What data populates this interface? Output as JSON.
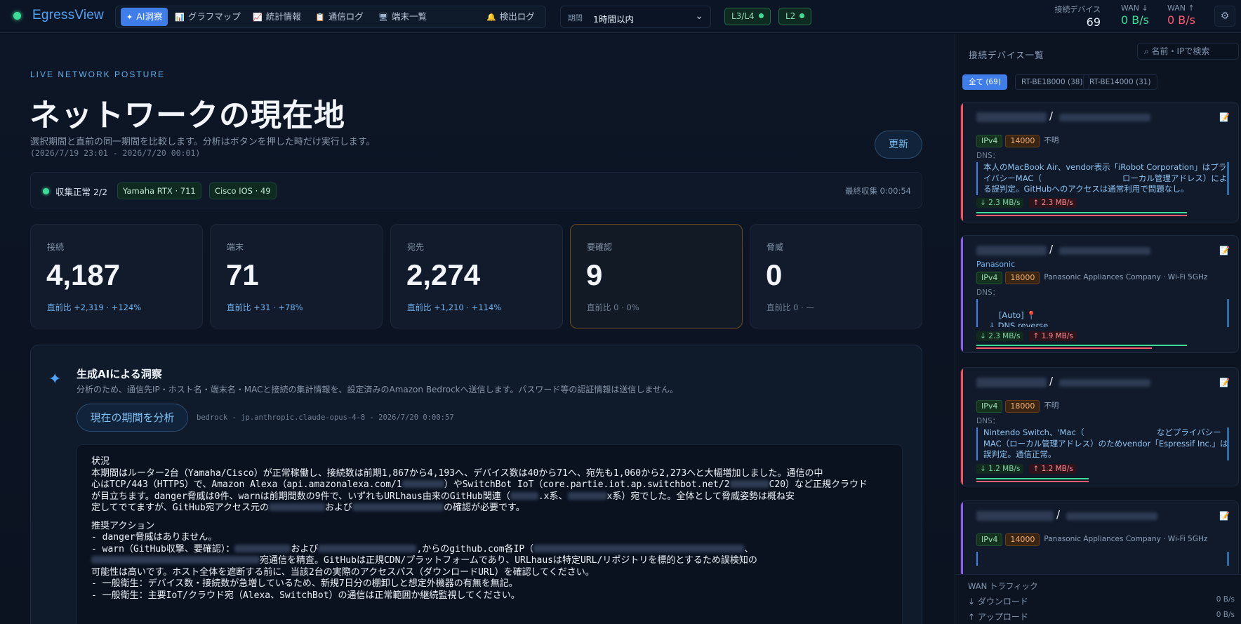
{
  "app": {
    "logo": "EgressView",
    "nav": [
      {
        "icon": "✦",
        "label": "AI洞察"
      },
      {
        "icon": "📊",
        "label": "グラフマップ"
      },
      {
        "icon": "📈",
        "label": "統計情報"
      },
      {
        "icon": "📋",
        "label": "通信ログ"
      },
      {
        "icon": "🖥",
        "label": "端末一覧"
      },
      {
        "icon": "🔔",
        "label": "検出ログ"
      }
    ],
    "period_label": "期間",
    "period_value": "1時間以内",
    "layers": [
      "L3/L4",
      "L2"
    ],
    "stats": {
      "devices_label": "接続デバイス",
      "devices_value": "69",
      "wan_down_label": "WAN ↓",
      "wan_down_value": "0 B/s",
      "wan_up_label": "WAN ↑",
      "wan_up_value": "0 B/s"
    }
  },
  "main": {
    "eyebrow": "LIVE NETWORK POSTURE",
    "title": "ネットワークの現在地",
    "subtitle": "選択期間と直前の同一期間を比較します。分析はボタンを押した時だけ実行します。",
    "range": "(2026/7/19 23:01 - 2026/7/20 00:01)",
    "refresh_label": "更新",
    "collect": {
      "status": "収集正常 2/2",
      "chips": [
        "Yamaha RTX · 711",
        "Cisco IOS · 49"
      ],
      "last": "最終収集 0:00:54"
    },
    "kpis": [
      {
        "label": "接続",
        "value": "4,187",
        "delta": "直前比 +2,319 · +124%"
      },
      {
        "label": "端末",
        "value": "71",
        "delta": "直前比 +31 · +78%"
      },
      {
        "label": "宛先",
        "value": "2,274",
        "delta": "直前比 +1,210 · +114%"
      },
      {
        "label": "要確認",
        "value": "9",
        "delta": "直前比 0 · 0%"
      },
      {
        "label": "脅威",
        "value": "0",
        "delta": "直前比 0 · —"
      }
    ],
    "ai": {
      "title": "生成AIによる洞察",
      "desc": "分析のため、通信先IP・ホスト名・端末名・MACと接続の集計情報を、設定済みのAmazon Bedrockへ送信します。パスワード等の認証情報は送信しません。",
      "analyze_label": "現在の期間を分析",
      "model": "bedrock - jp.anthropic.claude-opus-4-8 - 2026/7/20 0:00:57",
      "h1": "状況",
      "p1a": "本期間はルーター2台（Yamaha/Cisco）が正常稼働し、接続数は前期1,867から4,193へ、デバイス数は40から71へ、宛先も1,060から2,273へと大幅増加しました。通信の中",
      "p1b_pre": "心はTCP/443（HTTPS）で、Amazon Alexa（api.amazonalexa.com/1",
      "p1b_mid": "）やSwitchBot IoT（core.partie.iot.ap.switchbot.net/2",
      "p1b_post": "C20）など正規クラウド",
      "p1c_pre": "が目立ちます。danger脅威は0件、warnは前期間数の9件で、いずれもURLhaus由来のGitHub関連（",
      "p1c_mid": ".x系、",
      "p1c_post": "x系）宛でした。全体として脅威姿勢は概ね安",
      "p1d_pre": "定してでてますが、GitHub宛アクセス元の",
      "p1d_mid": "および",
      "p1d_post": "の確認が必要です。",
      "h2": "推奨アクション",
      "a1": "- danger脅威はありません。",
      "a2_pre": "- warn（GitHub収撃、要確認）：",
      "a2_mid": "および",
      "a2_post": ",からのgithub.com各IP（",
      "a2_end": "、",
      "a3_post": "宛通信を精査。GitHubは正規CDN/プラットフォームであり、URLhausは特定URL/リポジトリを標的とするため誤検知の",
      "a4": "可能性は高いです。ホスト全体を遮断する前に、当該2台の実際のアクセスパス（ダウンロードURL）を確認してください。",
      "a5": "- 一般衛生：デバイス数・接続数が急増しているため、新規7日分の棚卸しと想定外機器の有無を無記。",
      "a6": "- 一般衛生：主要IoT/クラウド宛（Alexa、SwitchBot）の通信は正常範囲か継続監視してください。"
    }
  },
  "sidebar": {
    "title": "接続デバイス一覧",
    "search_placeholder": "名前・IPで検索",
    "tabs": [
      "全て (69)",
      "RT-BE18000 (38)",
      "RT-BE14000 (31)"
    ],
    "devices": [
      {
        "accent": "#ff4d5e",
        "vendor": "",
        "ipv": "IPv4",
        "port": "14000",
        "info": "不明",
        "dns": "DNS：",
        "note": "本人のMacBook Air、vendor表示「iRobot Corporation」はプライバシーMAC（　　　　　　　　　　ローカル管理アドレス）による誤判定。GitHubへのアクセスは通常利用で問題なし。",
        "down": "↓ 2.3 MB/s",
        "up": "↑ 2.3 MB/s"
      },
      {
        "accent": "#8f5cf0",
        "vendor": "Panasonic",
        "ipv": "IPv4",
        "port": "18000",
        "info": "Panasonic Appliances Company · Wi-Fi 5GHz",
        "dns": "DNS：",
        "note": "[Auto] 📍\n  ↓ DNS reverse",
        "down": "↓ 2.3 MB/s",
        "up": "↑ 1.9 MB/s"
      },
      {
        "accent": "#ff4d5e",
        "vendor": "",
        "ipv": "IPv4",
        "port": "18000",
        "info": "不明",
        "dns": "DNS：",
        "note": "Nintendo Switch、'Mac（　　　　　　　　　などプライバシーMAC（ローカル管理アドレス）のためvendor「Espressif Inc.」は誤判定。通信正常。",
        "down": "↓ 1.2 MB/s",
        "up": "↑ 1.2 MB/s"
      },
      {
        "accent": "#8f5cf0",
        "vendor": "",
        "ipv": "IPv4",
        "port": "14000",
        "info": "Panasonic Appliances Company · Wi-Fi 5GHz",
        "dns": "",
        "note": "",
        "down": "",
        "up": ""
      }
    ],
    "wan": {
      "title": "WAN トラフィック",
      "down_label": "↓ ダウンロード",
      "down_value": "0 B/s",
      "up_label": "↑ アップロード",
      "up_value": "0 B/s"
    }
  }
}
